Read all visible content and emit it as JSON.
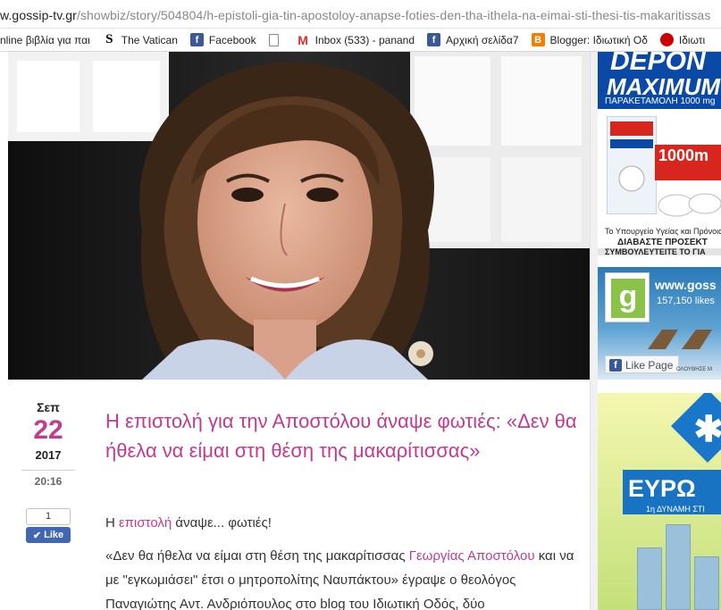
{
  "browser": {
    "url_host": "w.gossip-tv.gr",
    "url_path": "/showbiz/story/504804/h-epistoli-gia-tin-apostoloy-anapse-foties-den-tha-ithela-na-eimai-sti-thesi-tis-makaritissas"
  },
  "bookmarks": [
    {
      "label": "nline βιβλία για παι",
      "icon": "none"
    },
    {
      "label": "The Vatican",
      "icon": "s-icon"
    },
    {
      "label": "Facebook",
      "icon": "facebook-icon"
    },
    {
      "label": "",
      "icon": "document-icon"
    },
    {
      "label": "Inbox (533) - panand",
      "icon": "gmail-icon"
    },
    {
      "label": "Αρχική σελίδα7",
      "icon": "facebook-icon"
    },
    {
      "label": "Blogger: Ιδιωτική Οδ",
      "icon": "blogger-icon"
    },
    {
      "label": "Ιδιωτι",
      "icon": "red-circle-icon"
    }
  ],
  "ads": {
    "depon": {
      "brand": "DEPON",
      "product": "MAXIMUM",
      "subtitle": "ΠΑΡΑΚΕΤΑΜΟΛΗ 1000 mg",
      "dose": "1000m",
      "fine_print": "Το Υπουργείο Υγείας και Πρόνοιας κα",
      "warning1": "ΔΙΑΒΑΣΤΕ ΠΡΟΣΕΚΤ",
      "warning2": "ΣΥΜΒΟΥΛΕΥΤΕΙΤΕ ΤΟ ΓΙΑ"
    },
    "facebook_page": {
      "site": "www.goss",
      "likes": "157,150 likes",
      "like_button": "Like Page",
      "caption": "ΟΛΟΥΘΗΣΕ Μ"
    },
    "euro": {
      "brand": "ΕΥΡΩ",
      "slogan": "1η ΔΥΝΑΜΗ ΣΤΙ"
    }
  },
  "colors": {
    "accent": "#c23b8e",
    "facebook": "#4267b2"
  },
  "post": {
    "date": {
      "month": "Σεπ",
      "day": "22",
      "year": "2017",
      "time": "20:16"
    },
    "like": {
      "count": "1",
      "label": "Like"
    },
    "title": "Η επιστολή για την Αποστόλου άναψε φωτιές: «Δεν θα ήθελα να είμαι στη θέση της μακαρίτισσας»",
    "p1_before": "Η ",
    "p1_link": "επιστολή",
    "p1_after": " άναψε... φωτιές!",
    "p2_before": "«Δεν θα ήθελα να είμαι στη θέση της μακαρίτισσας ",
    "p2_link": "Γεωργίας Αποστόλου",
    "p2_after": " και να με \"εγκωμιάσει\" έτσι ο μητροπολίτης Ναυπάκτου» έγραψε ο θεολόγος Παναγιώτης Αντ. Ανδριόπουλος στο blog του Ιδιωτική Οδός, δύο"
  }
}
